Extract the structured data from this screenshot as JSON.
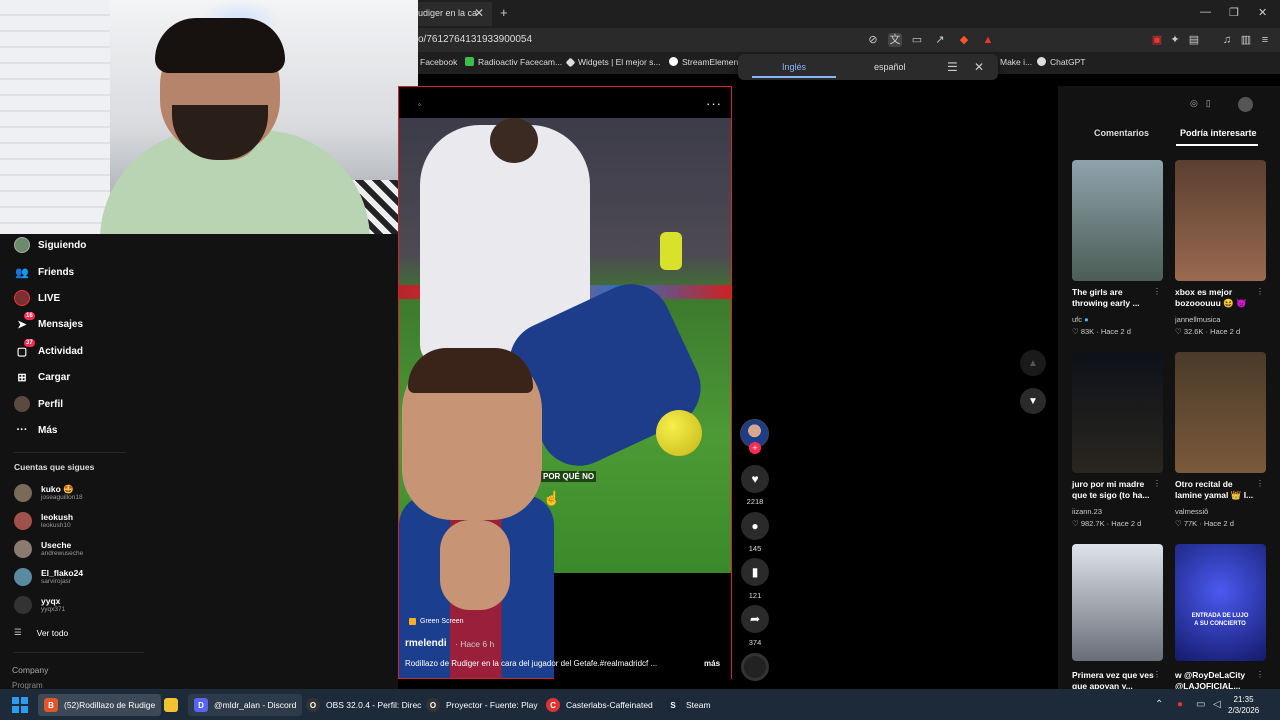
{
  "browser": {
    "tab_title": "udiger en la ca",
    "url": "o/7612764131933900054",
    "bookmarks": [
      "Facebook",
      "Radioactiv Facecam...",
      "Widgets | El mejor s...",
      "StreamElement",
      "Make i...",
      "ChatGPT"
    ],
    "translate": {
      "left": "Inglés",
      "right": "español"
    }
  },
  "sidebar": {
    "nav": [
      {
        "label": "Siguiendo",
        "icon": "following-avatar-icon"
      },
      {
        "label": "Friends",
        "icon": "friends-icon"
      },
      {
        "label": "LIVE",
        "icon": "live-icon"
      },
      {
        "label": "Mensajes",
        "icon": "messages-icon",
        "badge": "16"
      },
      {
        "label": "Actividad",
        "icon": "activity-icon",
        "badge": "37"
      },
      {
        "label": "Cargar",
        "icon": "upload-icon"
      },
      {
        "label": "Perfil",
        "icon": "profile-icon"
      },
      {
        "label": "Más",
        "icon": "more-icon"
      }
    ],
    "following_title": "Cuentas que sigues",
    "accounts": [
      {
        "name": "kuko 🤩",
        "handle": "joseaguillon18",
        "color": "#7a6a5a"
      },
      {
        "name": "leokush",
        "handle": "leokush10",
        "color": "#a0524a"
      },
      {
        "name": "Useche",
        "handle": "andrewuseche",
        "color": "#8a7a70"
      },
      {
        "name": "El_flako24",
        "handle": "sarvirojasr",
        "color": "#5a8aa0"
      },
      {
        "name": "yyqx",
        "handle": "yyqx371",
        "color": "#333"
      }
    ],
    "see_all": "Ver todo",
    "company": "Company",
    "program": "Program"
  },
  "video": {
    "caption_overlay": "POR QUÉ NO",
    "green_screen": "Green Screen",
    "author": "rmelendi",
    "posted": "· Hace 6 h",
    "description": "Rodillazo de Rudiger en la cara del jugador del Getafe.#realmadridcf ...",
    "more": "más",
    "likes": "2218",
    "comments": "145",
    "saves": "121",
    "shares": "374"
  },
  "right_panel": {
    "tab_comments": "Comentarios",
    "tab_interest": "Podría interesarte",
    "cards": [
      {
        "title": "The girls are throwing early ...",
        "author": "ufc",
        "likes": "83K",
        "time": "Hace 2 d",
        "bg": "#6b7f8a"
      },
      {
        "title": "xbox es mejor bozooouuu 😆 😈",
        "author": "jannellmusica",
        "likes": "32.6K",
        "time": "Hace 2 d",
        "bg": "#7a5a44"
      },
      {
        "title": "juro por mi madre que te sigo (to ha...",
        "author": "iizann.23",
        "likes": "982.7K",
        "time": "Hace 2 d",
        "bg": "#1a1f2a"
      },
      {
        "title": "Otro recital de lamine yamal 👑 I...",
        "author": "valmessiô",
        "likes": "77K",
        "time": "Hace 2 d",
        "bg": "#6e5a40"
      },
      {
        "title": "Primera vez que ves que apoyan y...",
        "author": "",
        "likes": "",
        "time": "",
        "bg": "#8a8f99"
      },
      {
        "title": "w @RoyDeLaCity @LAJOFICIAL...",
        "author": "",
        "likes": "",
        "time": "",
        "bg": "#2a2f8a"
      }
    ],
    "card5_overlay": "ENTRADA DE LUJO A SU CONCIERTO"
  },
  "taskbar": {
    "items": [
      {
        "label": "(52)Rodillazo de Rudige",
        "icon_bg": "#e0552c",
        "glyph": "B"
      },
      {
        "label": "",
        "icon_bg": "#f2c230",
        "glyph": ""
      },
      {
        "label": "@mldr_alan - Discord",
        "icon_bg": "#5865f2",
        "glyph": "D"
      },
      {
        "label": "OBS 32.0.4 - Perfil: Direc",
        "icon_bg": "#333",
        "glyph": "O"
      },
      {
        "label": "Proyector - Fuente: Play",
        "icon_bg": "#333",
        "glyph": "O"
      },
      {
        "label": "Casterlabs-Caffeinated",
        "icon_bg": "#d33",
        "glyph": "C"
      },
      {
        "label": "Steam",
        "icon_bg": "#1b2838",
        "glyph": "S"
      }
    ],
    "time": "21:35",
    "date": "2/3/2026"
  }
}
